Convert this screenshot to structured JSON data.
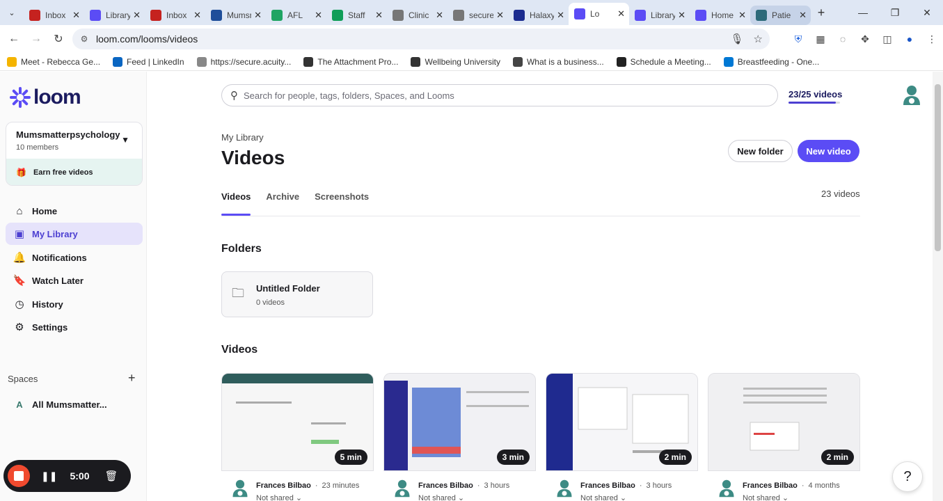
{
  "browser": {
    "tabs": [
      {
        "label": "Inbox",
        "icon": "gmail-icon",
        "color": "#c5221f"
      },
      {
        "label": "Library",
        "icon": "loom-icon",
        "color": "#5b4cf5"
      },
      {
        "label": "Inbox",
        "icon": "gmail-icon",
        "color": "#c5221f"
      },
      {
        "label": "Mumsmatter",
        "icon": "monday-icon",
        "color": "#1f4e9a"
      },
      {
        "label": "AFL",
        "icon": "drive-icon",
        "color": "#1fa463"
      },
      {
        "label": "Staff",
        "icon": "sheets-icon",
        "color": "#0f9d58"
      },
      {
        "label": "Clinic",
        "icon": "clinic-icon",
        "color": "#777777"
      },
      {
        "label": "secure",
        "icon": "acuity-icon",
        "color": "#777777"
      },
      {
        "label": "Halaxy",
        "icon": "halaxy-icon",
        "color": "#1b2b8f"
      },
      {
        "label": "Lo",
        "icon": "loom-icon",
        "color": "#5b4cf5",
        "active": true
      },
      {
        "label": "Library",
        "icon": "loom-icon",
        "color": "#5b4cf5"
      },
      {
        "label": "Home",
        "icon": "loom-icon",
        "color": "#5b4cf5"
      },
      {
        "label": "Patie",
        "icon": "globe-icon",
        "color": "#2d6a7a",
        "hover": true
      }
    ],
    "url": "loom.com/looms/videos",
    "bookmarks": [
      {
        "label": "Meet - Rebecca Ge...",
        "color": "#f4b400"
      },
      {
        "label": "Feed | LinkedIn",
        "color": "#0a66c2"
      },
      {
        "label": "https://secure.acuity...",
        "color": "#888888"
      },
      {
        "label": "The Attachment Pro...",
        "color": "#333333"
      },
      {
        "label": "Wellbeing University",
        "color": "#333333"
      },
      {
        "label": "What is a business...",
        "color": "#444444"
      },
      {
        "label": "Schedule a Meeting...",
        "color": "#222222"
      },
      {
        "label": "Breastfeeding - One...",
        "color": "#0078d4"
      }
    ]
  },
  "sidebar": {
    "logo_text": "loom",
    "workspace": {
      "name": "Mumsmatterpsychology",
      "members": "10 members",
      "earn": "Earn free videos"
    },
    "nav": [
      {
        "label": "Home",
        "icon": "home-icon",
        "glyph": "⌂"
      },
      {
        "label": "My Library",
        "icon": "library-icon",
        "glyph": "▣",
        "active": true
      },
      {
        "label": "Notifications",
        "icon": "bell-icon",
        "glyph": "🔔"
      },
      {
        "label": "Watch Later",
        "icon": "bookmark-icon",
        "glyph": "🔖"
      },
      {
        "label": "History",
        "icon": "clock-icon",
        "glyph": "◷"
      },
      {
        "label": "Settings",
        "icon": "gear-icon",
        "glyph": "⚙"
      }
    ],
    "spaces_heading": "Spaces",
    "space": {
      "initial": "A",
      "label": "All Mumsmatter..."
    }
  },
  "recorder": {
    "time": "5:00"
  },
  "main": {
    "search_placeholder": "Search for people, tags, folders, Spaces, and Looms",
    "quota": "23/25 videos",
    "quota_fraction": 0.92,
    "breadcrumb": "My Library",
    "title": "Videos",
    "new_folder": "New folder",
    "new_video": "New video",
    "tabs": [
      "Videos",
      "Archive",
      "Screenshots"
    ],
    "count": "23 videos",
    "folders_heading": "Folders",
    "folder": {
      "name": "Untitled Folder",
      "count": "0 videos"
    },
    "videos_heading": "Videos",
    "videos": [
      {
        "duration": "5 min",
        "author": "Frances Bilbao",
        "time": "23 minutes",
        "share": "Not shared",
        "theme": "#2f5d5c"
      },
      {
        "duration": "3 min",
        "author": "Frances Bilbao",
        "time": "3 hours",
        "share": "Not shared",
        "theme": "#2a2a8f"
      },
      {
        "duration": "2 min",
        "author": "Frances Bilbao",
        "time": "3 hours",
        "share": "Not shared",
        "theme": "#1f2a8f"
      },
      {
        "duration": "2 min",
        "author": "Frances Bilbao",
        "time": "4 months",
        "share": "Not shared",
        "theme": "#e8e8ea"
      }
    ]
  },
  "colors": {
    "accent": "#5b4cf5",
    "brand_dark": "#1b1b5f",
    "earn_bg": "#e6f4f1"
  }
}
